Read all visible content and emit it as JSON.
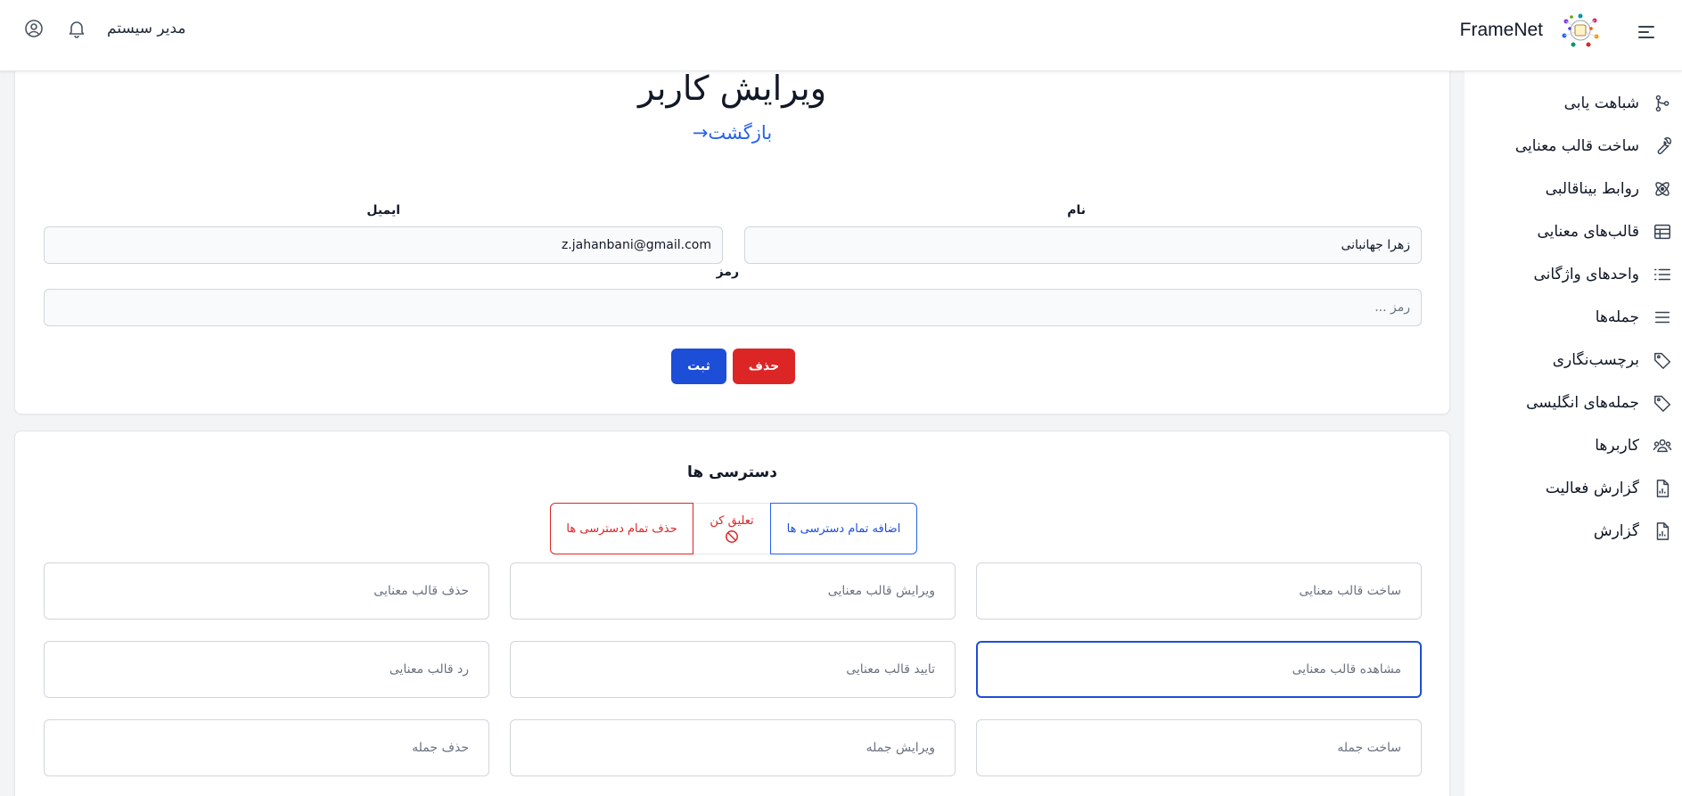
{
  "header": {
    "brand": "FrameNet",
    "user_name": "مدیر سیستم"
  },
  "sidebar": {
    "items": [
      {
        "label": "شباهت یابی",
        "icon": "git-branch-icon"
      },
      {
        "label": "ساخت قالب معنایی",
        "icon": "wrench-icon"
      },
      {
        "label": "روابط بیناقالبی",
        "icon": "atom-icon"
      },
      {
        "label": "قالب‌های معنایی",
        "icon": "table-icon"
      },
      {
        "label": "واحدهای واژگانی",
        "icon": "list-icon"
      },
      {
        "label": "جمله‌ها",
        "icon": "lines-icon"
      },
      {
        "label": "برچسب‌نگاری",
        "icon": "tag-icon"
      },
      {
        "label": "جمله‌های انگلیسی",
        "icon": "tag-icon"
      },
      {
        "label": "کاربرها",
        "icon": "users-icon"
      },
      {
        "label": "گزارش فعالیت",
        "icon": "report-icon"
      },
      {
        "label": "گزارش",
        "icon": "report-icon"
      }
    ]
  },
  "form": {
    "title": "ویرایش کاربر",
    "back_label": "بازگشت",
    "back_arrow": "→",
    "name_label": "نام",
    "name_value": "زهرا جهانبانی",
    "email_label": "ایمیل",
    "email_value": "z.jahanbani@gmail.com",
    "password_label": "رمز",
    "password_placeholder": "رمز ...",
    "delete_label": "حذف",
    "save_label": "ثبت"
  },
  "permissions": {
    "title": "دسترسی ها",
    "add_all_label": "اضافه تمام دسترسی ها",
    "suspend_label": "تعلیق کن",
    "remove_all_label": "حذف تمام دسترسی ها",
    "items": [
      {
        "label": "ساخت قالب معنایی",
        "active": false
      },
      {
        "label": "ویرایش قالب معنایی",
        "active": false
      },
      {
        "label": "حذف قالب معنایی",
        "active": false
      },
      {
        "label": "مشاهده قالب معنایی",
        "active": true
      },
      {
        "label": "تایید قالب معنایی",
        "active": false
      },
      {
        "label": "رد قالب معنایی",
        "active": false
      },
      {
        "label": "ساخت جمله",
        "active": false
      },
      {
        "label": "ویرایش جمله",
        "active": false
      },
      {
        "label": "حذف جمله",
        "active": false
      }
    ]
  },
  "colors": {
    "primary": "#1d4ed8",
    "danger": "#dc2626",
    "link": "#2563eb",
    "background": "#f3f4f6"
  }
}
